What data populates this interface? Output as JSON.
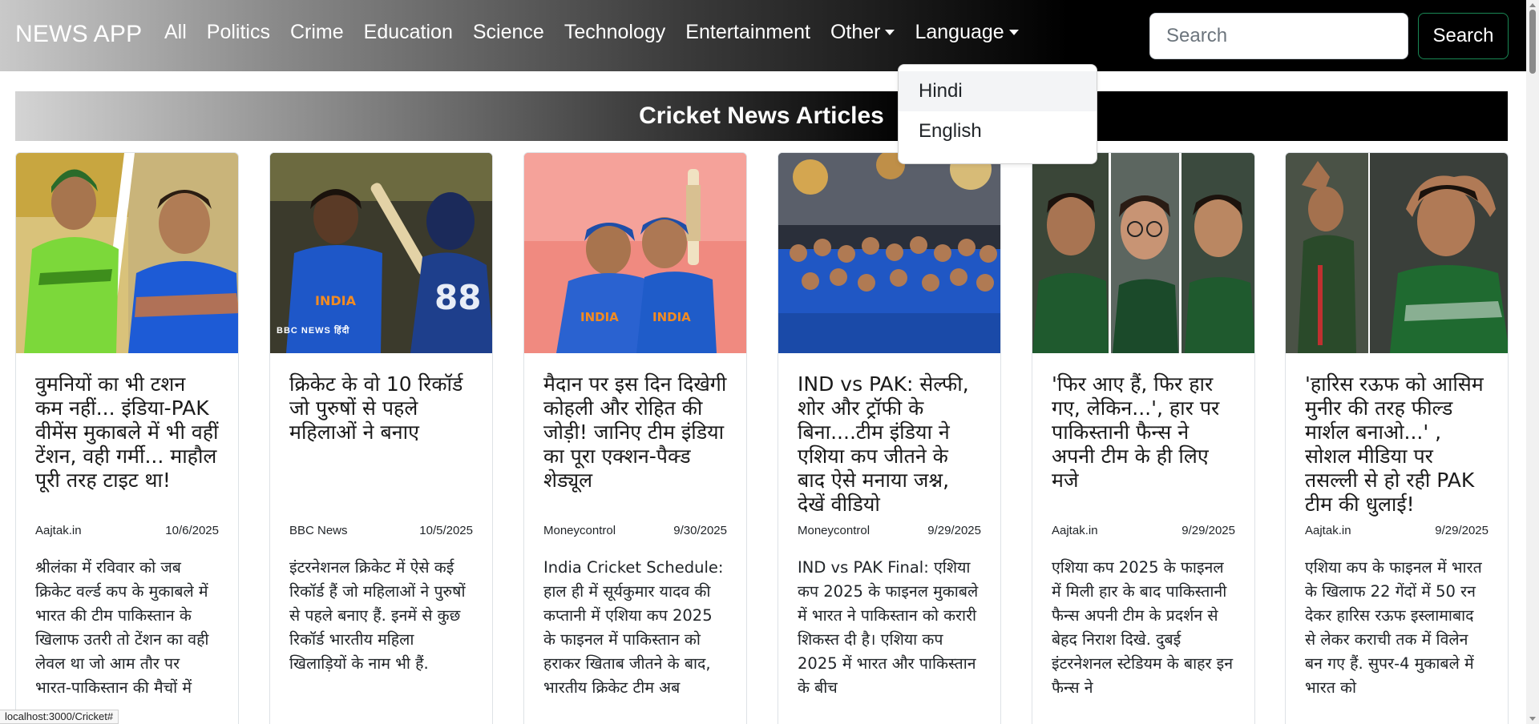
{
  "navbar": {
    "brand": "NEWS APP",
    "links": [
      "All",
      "Politics",
      "Crime",
      "Education",
      "Science",
      "Technology",
      "Entertainment"
    ],
    "other_label": "Other",
    "language_label": "Language",
    "search_placeholder": "Search",
    "search_button": "Search"
  },
  "dropdown": {
    "items": [
      "Hindi",
      "English"
    ]
  },
  "section": {
    "title": "Cricket News Articles"
  },
  "articles": [
    {
      "title": "वुमनियों का भी टशन कम नहीं... इंडिया-PAK वीमेंस मुकाबले में भी वहीं टेंशन, वही गर्मी... माहौल पूरी तरह टाइट था!",
      "source": "Aajtak.in",
      "date": "10/6/2025",
      "description": "श्रीलंका में रविवार को जब क्रिकेट वर्ल्ड कप के मुकाबले में भारत की टीम पाकिस्तान के खिलाफ उतरी तो टेंशन का वही लेवल था जो आम तौर पर भारत-पाकिस्तान की मैचों में"
    },
    {
      "title": "क्रिकेट के वो 10 रिकॉर्ड जो पुरुषों से पहले महिलाओं ने बनाए",
      "source": "BBC News",
      "date": "10/5/2025",
      "description": "इंटरनेशनल क्रिकेट में ऐसे कई रिकॉर्ड हैं जो महिलाओं ने पुरुषों से पहले बनाए हैं. इनमें से कुछ रिकॉर्ड भारतीय महिला खिलाड़ियों के नाम भी हैं."
    },
    {
      "title": "मैदान पर इस दिन दिखेगी कोहली और रोहित की जोड़ी! जानिए टीम इंडिया का पूरा एक्शन-पैक्ड शेड्यूल",
      "source": "Moneycontrol",
      "date": "9/30/2025",
      "description": "India Cricket Schedule: हाल ही में सूर्यकुमार यादव की कप्तानी में एशिया कप 2025 के फाइनल में पाकिस्तान को हराकर खिताब जीतने के बाद, भारतीय क्रिकेट टीम अब"
    },
    {
      "title": "IND vs PAK: सेल्फी, शोर और ट्रॉफी के बिना....टीम इंडिया ने एशिया कप जीतने के बाद ऐसे मनाया जश्न, देखें वीडियो",
      "source": "Moneycontrol",
      "date": "9/29/2025",
      "description": "IND vs PAK Final: एशिया कप 2025 के फाइनल मुकाबले में भारत ने पाकिस्तान को करारी शिकस्त दी है। एशिया कप 2025 में भारत और पाकिस्तान के बीच"
    },
    {
      "title": "'फिर आए हैं, फिर हार गए, लेकिन...', हार पर पाकिस्तानी फैन्स ने अपनी टीम के ही लिए मजे",
      "source": "Aajtak.in",
      "date": "9/29/2025",
      "description": "एशिया कप 2025 के फाइनल में मिली हार के बाद पाकिस्तानी फैन्स अपनी टीम के प्रदर्शन से बेहद निराश दिखे. दुबई इंटरनेशनल स्टेडियम के बाहर इन फैन्स ने"
    },
    {
      "title": "'हारिस रऊफ को आसिम मुनीर की तरह फील्ड मार्शल बनाओ...' , सोशल मीडिया पर तसल्ली से हो रही PAK टीम की धुलाई!",
      "source": "Aajtak.in",
      "date": "9/29/2025",
      "description": "एशिया कप के फाइनल में भारत के खिलाफ 22 गेंदों में 50 रन देकर हारिस रऊफ इस्लामाबाद से लेकर कराची तक में विलेन बन गए हैं. सुपर-4 मुकाबले में भारत को"
    }
  ],
  "image_captions": {
    "bbc_watermark": "BBC NEWS हिंदी"
  },
  "status_bar": "localhost:3000/Cricket#"
}
